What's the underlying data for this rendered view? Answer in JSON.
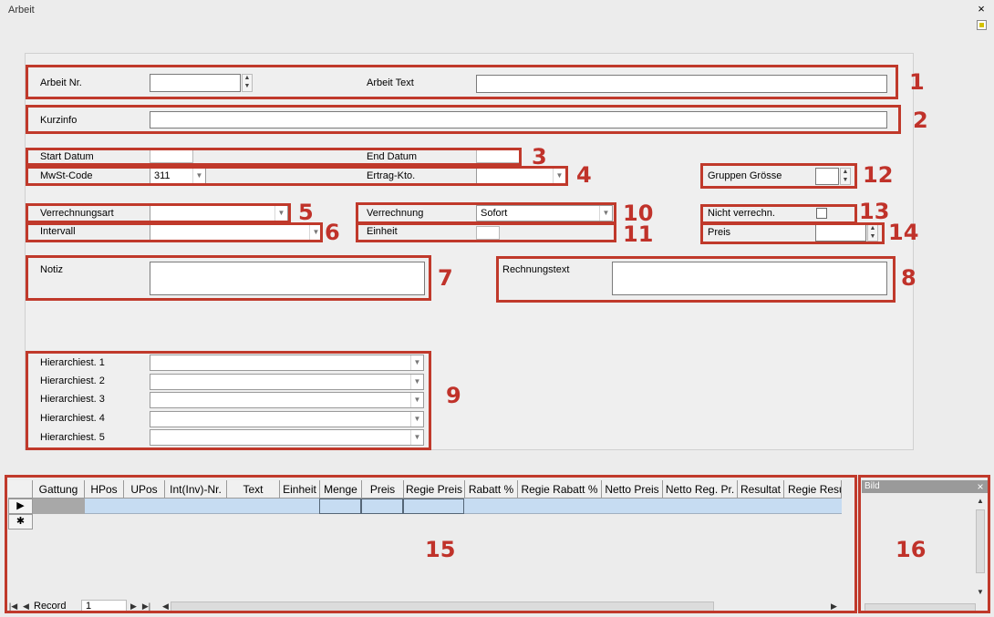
{
  "window": {
    "title": "Arbeit",
    "close_glyph": "×"
  },
  "form": {
    "arbeit_nr": {
      "label": "Arbeit Nr.",
      "value": ""
    },
    "arbeit_text": {
      "label": "Arbeit Text",
      "value": ""
    },
    "kurzinfo": {
      "label": "Kurzinfo",
      "value": ""
    },
    "start_datum": {
      "label": "Start Datum",
      "value": ""
    },
    "end_datum": {
      "label": "End Datum",
      "value": ""
    },
    "mwst_code": {
      "label": "MwSt-Code",
      "value": "311"
    },
    "ertrag_kto": {
      "label": "Ertrag-Kto.",
      "value": ""
    },
    "gruppen_groesse": {
      "label": "Gruppen Grösse",
      "value": ""
    },
    "verrechnungsart": {
      "label": "Verrechnungsart",
      "value": ""
    },
    "verrechnung": {
      "label": "Verrechnung",
      "value": "Sofort"
    },
    "nicht_verrechn": {
      "label": "Nicht verrechn.",
      "checked": false
    },
    "intervall": {
      "label": "Intervall",
      "value": ""
    },
    "einheit": {
      "label": "Einheit",
      "value": ""
    },
    "preis": {
      "label": "Preis",
      "value": ""
    },
    "notiz": {
      "label": "Notiz",
      "value": ""
    },
    "rechnungstext": {
      "label": "Rechnungstext",
      "value": ""
    },
    "hierarchie": [
      {
        "label": "Hierarchiest. 1",
        "value": ""
      },
      {
        "label": "Hierarchiest. 2",
        "value": ""
      },
      {
        "label": "Hierarchiest. 3",
        "value": ""
      },
      {
        "label": "Hierarchiest. 4",
        "value": ""
      },
      {
        "label": "Hierarchiest. 5",
        "value": ""
      }
    ]
  },
  "grid": {
    "columns": [
      "Gattung",
      "HPos",
      "UPos",
      "Int(Inv)-Nr.",
      "Text",
      "Einheit",
      "Menge",
      "Preis",
      "Regie Preis",
      "Rabatt %",
      "Regie Rabatt %",
      "Netto Preis",
      "Netto Reg. Pr.",
      "Resultat",
      "Regie Resu"
    ],
    "row_indicators": [
      "▶",
      "✱"
    ],
    "nav": {
      "label": "Record",
      "value": "1"
    }
  },
  "bild": {
    "title": "Bild",
    "close_glyph": "×"
  },
  "annotations": [
    "1",
    "2",
    "3",
    "4",
    "5",
    "6",
    "7",
    "8",
    "9",
    "10",
    "11",
    "12",
    "13",
    "14",
    "15",
    "16"
  ],
  "colors": {
    "annotation": "#c0392b",
    "selected_row": "#c6dcf2"
  }
}
